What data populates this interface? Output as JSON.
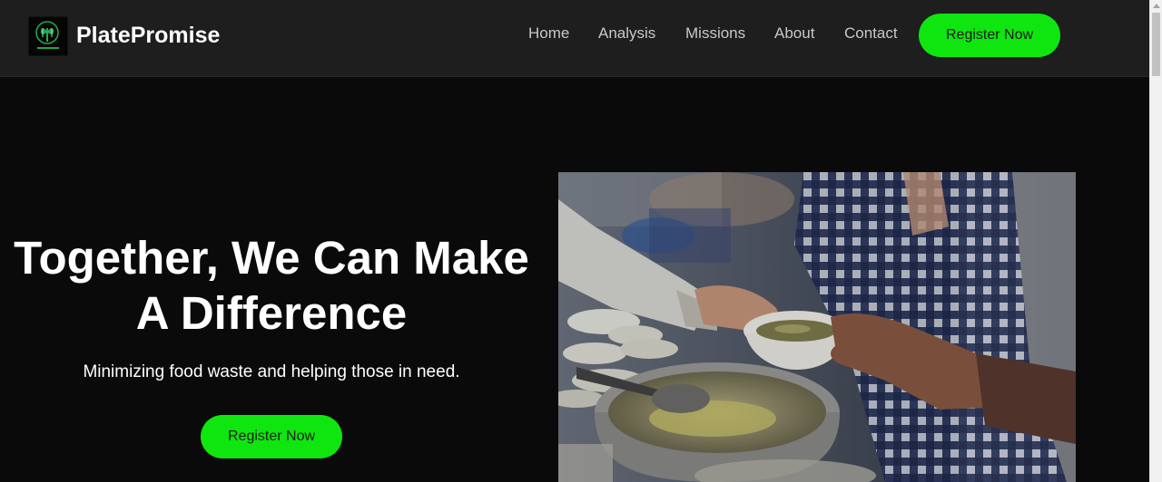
{
  "brand": {
    "name": "PlatePromise",
    "logo_icon": "plate-leaf-logo-icon",
    "logo_accent": "#1fa84a"
  },
  "nav": {
    "links": [
      "Home",
      "Analysis",
      "Missions",
      "About",
      "Contact"
    ],
    "cta_label": "Register Now"
  },
  "hero": {
    "title_line1": "Together, We Can Make",
    "title_line2": "A Difference",
    "subtitle": "Minimizing food waste and helping those in need.",
    "cta_label": "Register Now",
    "image": "photo-food-serving"
  },
  "colors": {
    "accent": "#0fe60f",
    "navbar_bg": "#1e1e1e",
    "page_bg": "#0a0a0a",
    "nav_text": "#c8c8c8"
  }
}
